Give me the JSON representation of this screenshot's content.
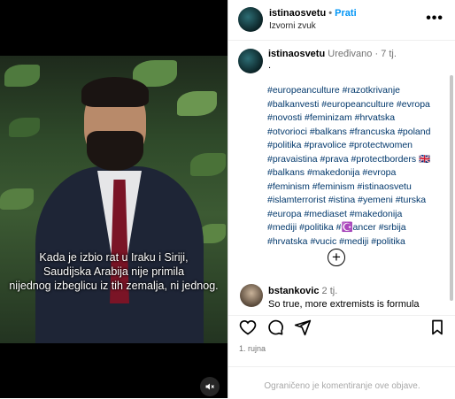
{
  "header": {
    "username": "istinaosvetu",
    "separator": "•",
    "follow_label": "Prati",
    "audio_label": "Izvorni zvuk",
    "more": "•••"
  },
  "video": {
    "subtitle_lines": [
      "Kada je izbio rat u Iraku i Siriji,",
      "Saudijska Arabija nije primila",
      "nijednog izbeglicu iz tih zemalja, ni jednog."
    ]
  },
  "caption": {
    "username": "istinaosvetu",
    "edited": "Uređivano",
    "time": "7 tj.",
    "first_line": ".",
    "hashtag_lines": [
      "#europeanculture #razotkrivanje",
      "#balkanvesti #europeanculture #evropa",
      "#novosti #feminizam #hrvatska",
      "#otvorioci #balkans #francuska #poland",
      "#politika #pravolice #protectwomen",
      "#pravaistina #prava  #protectborders 🇬🇧",
      "#balkans #makedonija #evropa",
      "#feminism #feminism #istinaosvetu",
      "#islamterrorist #istina #yemeni #turska",
      "#europa #mediaset #makedonija",
      "#mediji #politika  #☪️ancer #srbija",
      "#hrvatska #vucic #mediji #politika"
    ],
    "flag_text": "GB",
    "expand_symbol": "+"
  },
  "comment": {
    "username": "bstankovic",
    "time": "2 tj.",
    "text": "So true, more extremists is formula"
  },
  "post": {
    "date": "1. rujna",
    "comments_disabled": "Ograničeno je komentiranje ove objave."
  }
}
